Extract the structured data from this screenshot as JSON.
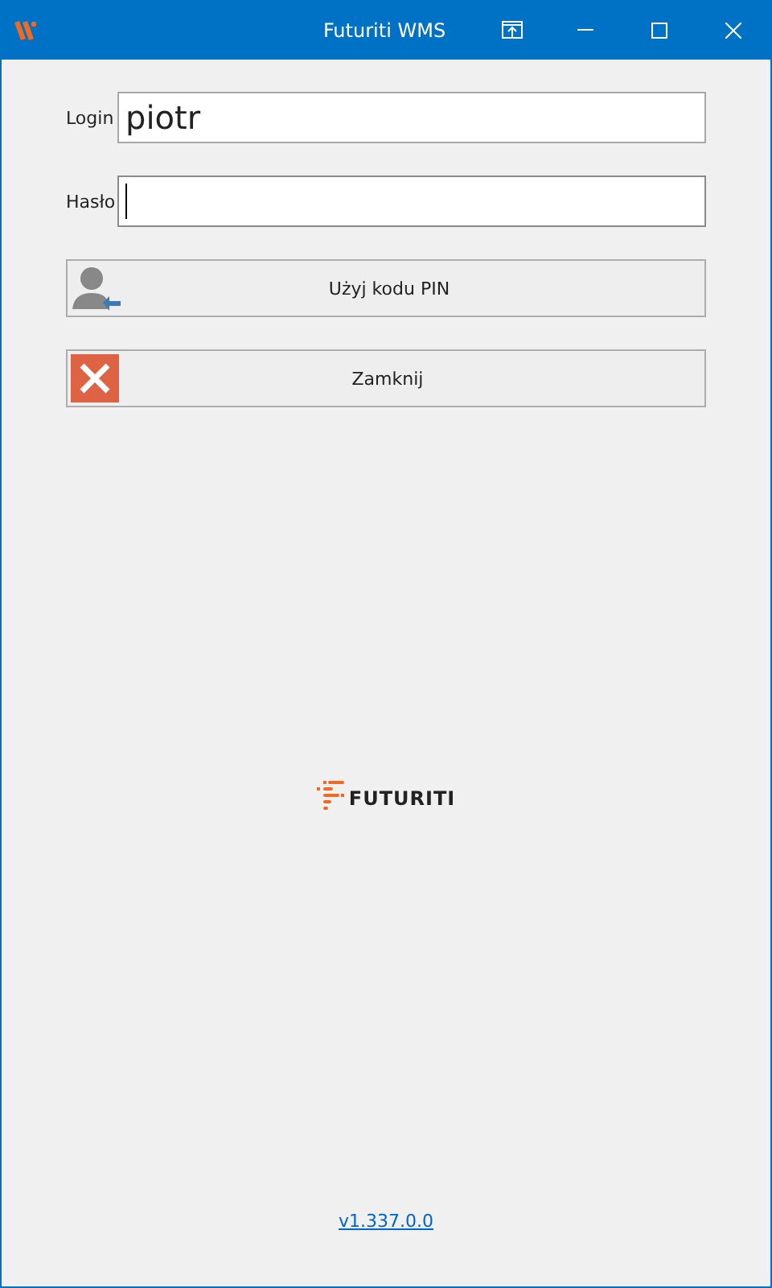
{
  "window": {
    "title": "Futuriti WMS"
  },
  "fields": [
    {
      "label": "Login",
      "value": "piotr",
      "focused": false
    },
    {
      "label": "Hasło",
      "focused": true
    }
  ],
  "buttons": [
    {
      "kind": "pin",
      "label": "Użyj kodu PIN"
    },
    {
      "kind": "close",
      "label": "Zamknij"
    }
  ],
  "logo": {
    "text": "FUTURITI"
  },
  "version": "v1.337.0.0"
}
